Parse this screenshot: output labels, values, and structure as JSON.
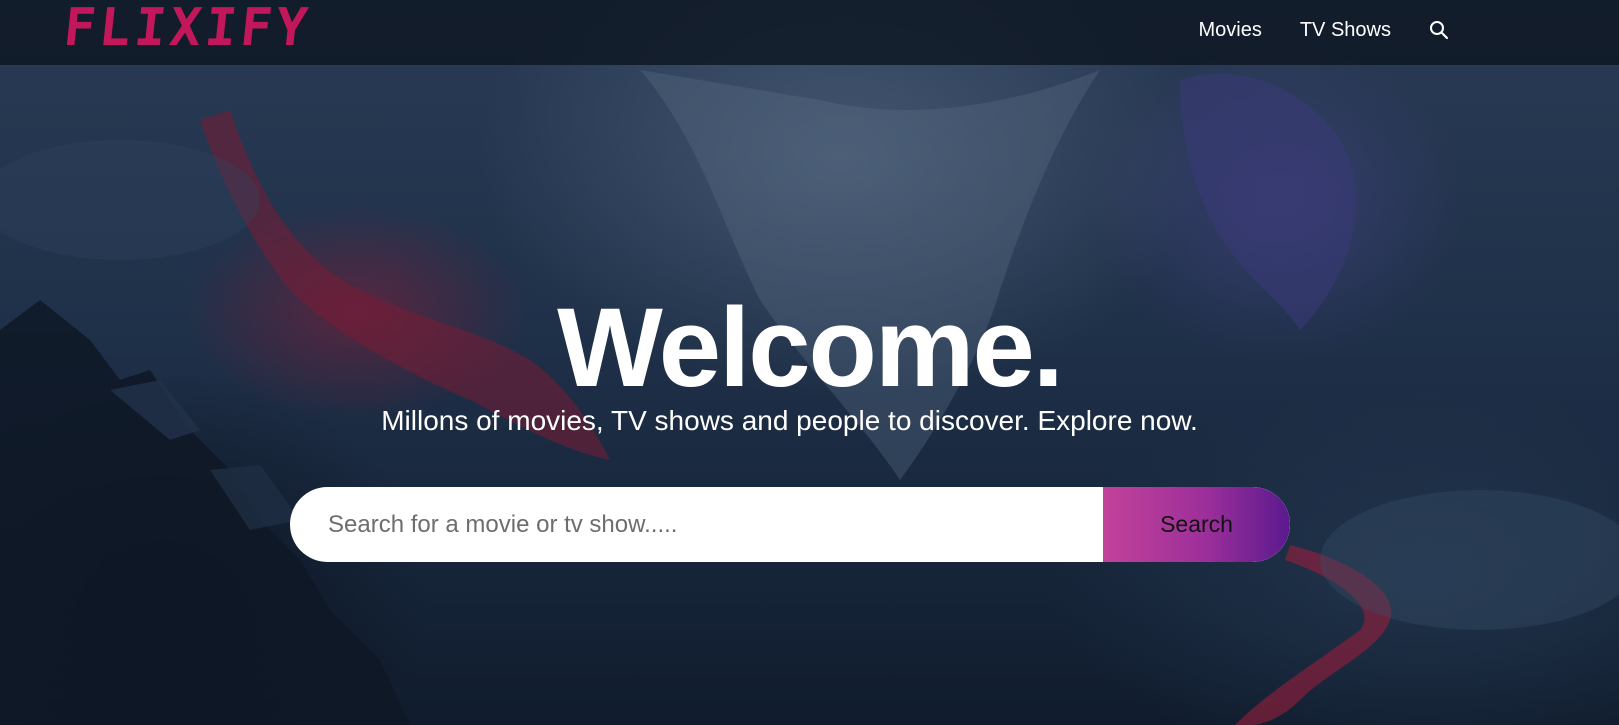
{
  "brand": {
    "name": "FLIXIFY",
    "color": "#c2185b"
  },
  "nav": {
    "items": [
      {
        "label": "Movies"
      },
      {
        "label": "TV Shows"
      }
    ],
    "search_icon": "search-icon"
  },
  "hero": {
    "title": "Welcome.",
    "subtitle": "Millons of movies, TV shows and people to discover. Explore now.",
    "search": {
      "placeholder": "Search for a movie or tv show.....",
      "value": "",
      "button_label": "Search",
      "button_gradient": [
        "#c2429a",
        "#5a1a8e"
      ]
    }
  },
  "colors": {
    "nav_background": "#0c1420",
    "hero_text": "#ffffff",
    "accent": "#c2185b"
  }
}
